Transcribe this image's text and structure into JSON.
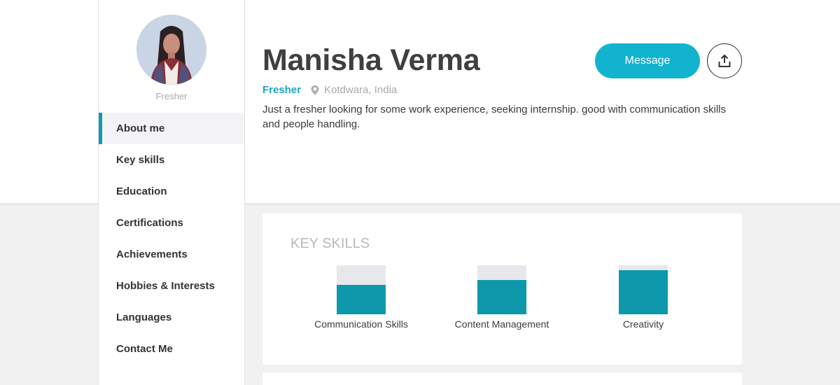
{
  "profile": {
    "name": "Manisha Verma",
    "status": "Fresher",
    "location": "Kotdwara, India",
    "bio": "Just a fresher looking for some work experience, seeking internship. good with communication skills and people handling.",
    "avatar_caption": "Fresher"
  },
  "actions": {
    "message_label": "Message",
    "share_icon": "share-icon"
  },
  "sidebar": {
    "items": [
      {
        "label": "About me",
        "active": true
      },
      {
        "label": "Key skills"
      },
      {
        "label": "Education"
      },
      {
        "label": "Certifications"
      },
      {
        "label": "Achievements"
      },
      {
        "label": "Hobbies & Interests"
      },
      {
        "label": "Languages"
      },
      {
        "label": "Contact Me"
      }
    ]
  },
  "key_skills": {
    "title": "KEY SKILLS",
    "skills": [
      {
        "name": "Communication Skills",
        "level": 0.6
      },
      {
        "name": "Content Management",
        "level": 0.7
      },
      {
        "name": "Creativity",
        "level": 0.9
      }
    ]
  },
  "colors": {
    "accent": "#12b3cf",
    "bar_fill": "#0e98ab",
    "status": "#1aa7c3"
  }
}
